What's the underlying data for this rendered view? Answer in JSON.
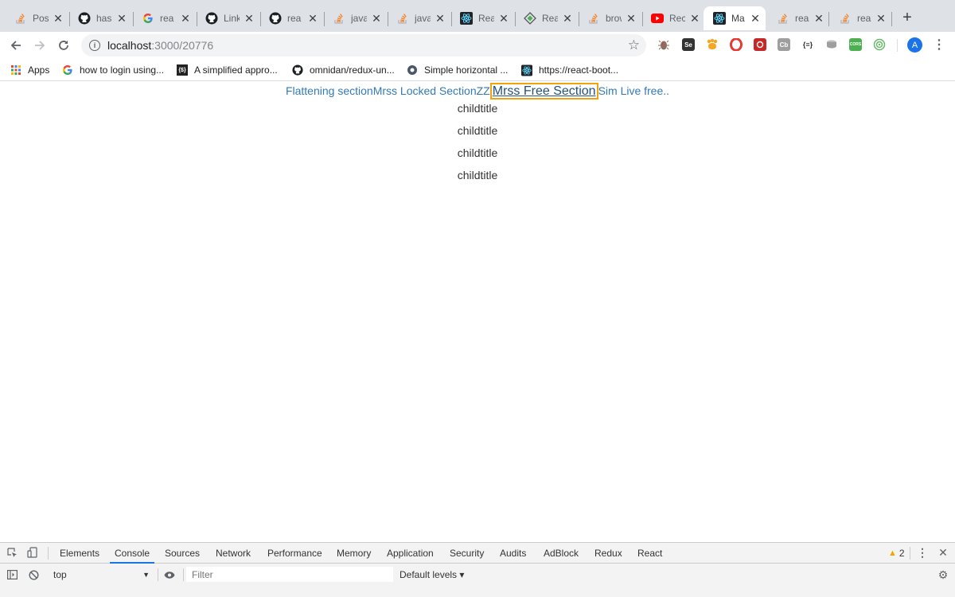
{
  "browser": {
    "tabs": [
      {
        "title": "Pos",
        "icon": "stackoverflow-icon"
      },
      {
        "title": "has",
        "icon": "github-icon"
      },
      {
        "title": "rea",
        "icon": "google-icon"
      },
      {
        "title": "Link",
        "icon": "github-icon"
      },
      {
        "title": "rea",
        "icon": "github-icon"
      },
      {
        "title": "java",
        "icon": "stackoverflow-icon"
      },
      {
        "title": "java",
        "icon": "stackoverflow-icon"
      },
      {
        "title": "Rea",
        "icon": "react-icon"
      },
      {
        "title": "Rea",
        "icon": "diamond-icon"
      },
      {
        "title": "brow",
        "icon": "stackoverflow-icon"
      },
      {
        "title": "Rec",
        "icon": "youtube-icon"
      },
      {
        "title": "Ma",
        "icon": "react-icon",
        "active": true
      },
      {
        "title": "rea",
        "icon": "stackoverflow-icon"
      },
      {
        "title": "rea",
        "icon": "stackoverflow-icon"
      }
    ],
    "address": {
      "host": "localhost",
      "path": ":3000/20776"
    },
    "avatar_letter": "A",
    "extensions": [
      {
        "label": "",
        "color": "#8d6e63"
      },
      {
        "label": "Se",
        "color": "#444444"
      },
      {
        "label": "",
        "color": "#f5a623"
      },
      {
        "label": "",
        "color": "#e53935"
      },
      {
        "label": "",
        "color": "#c62828"
      },
      {
        "label": "Cb",
        "color": "#9e9e9e"
      },
      {
        "label": "{≡}",
        "color": "#ffffff"
      },
      {
        "label": "",
        "color": "#bdbdbd"
      },
      {
        "label": "CORS",
        "color": "#4caf50"
      },
      {
        "label": "",
        "color": "#66bb6a"
      }
    ]
  },
  "bookmarks": [
    {
      "label": "Apps",
      "icon": "apps-grid-icon"
    },
    {
      "label": "how to login using...",
      "icon": "google-icon"
    },
    {
      "label": "A simplified appro...",
      "icon": "braces-icon"
    },
    {
      "label": "omnidan/redux-un...",
      "icon": "github-icon"
    },
    {
      "label": "Simple horizontal ...",
      "icon": "circle-icon"
    },
    {
      "label": "https://react-boot...",
      "icon": "react-icon"
    }
  ],
  "page": {
    "sections": [
      {
        "label": "Flattening section"
      },
      {
        "label": "Mrss Locked SectionZZ"
      },
      {
        "label": "Mrss Free Section",
        "active": true
      },
      {
        "label": "Sim Live free.."
      }
    ],
    "children": [
      "childtitle",
      "childtitle",
      "childtitle",
      "childtitle"
    ]
  },
  "devtools": {
    "tabs": [
      "Elements",
      "Console",
      "Sources",
      "Network",
      "Performance",
      "Memory",
      "Application",
      "Security",
      "Audits",
      "AdBlock",
      "Redux",
      "React"
    ],
    "active_tab": "Console",
    "warnings": "2",
    "context": "top",
    "filter_placeholder": "Filter",
    "levels": "Default levels ▾"
  }
}
